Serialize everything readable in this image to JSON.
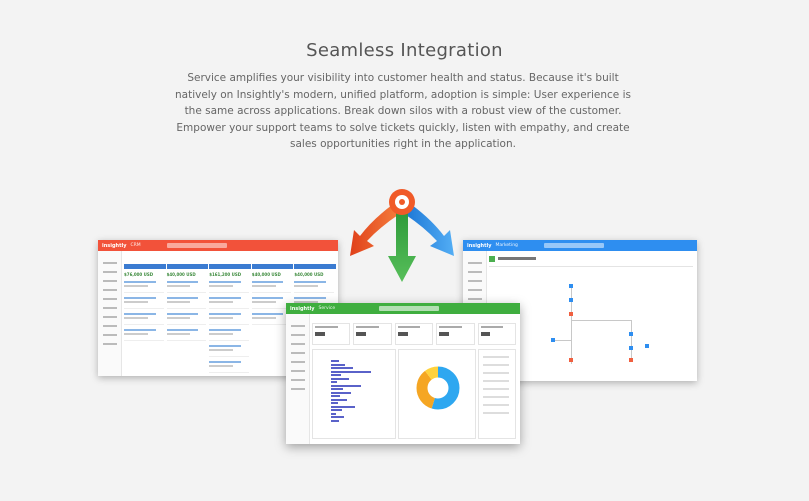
{
  "section": {
    "title": "Seamless Integration",
    "description": "Service amplifies your visibility into customer health and status.  Because it's built natively on Insightly's modern, unified platform, adoption is simple: User experience is the same across applications. Break down silos with a robust view of the customer. Empower your support teams to solve tickets quickly, listen with empathy, and create sales opportunities right in the application."
  },
  "screens": {
    "crm": {
      "logo": "insightly",
      "module": "CRM",
      "bar_color": "#f2523a",
      "column_totals": [
        "$76,000 USD",
        "$40,000 USD",
        "$161,200 USD",
        "$40,000 USD",
        "$40,000 USD"
      ]
    },
    "service": {
      "logo": "insightly",
      "module": "Service",
      "bar_color": "#3fae3f"
    },
    "flow": {
      "logo": "insightly",
      "module": "Marketing",
      "bar_color": "#2e8ef0"
    }
  },
  "hub": {
    "arrow_colors": {
      "orange": "#f05a28",
      "green": "#3aa844",
      "blue": "#2f8ee8"
    }
  }
}
